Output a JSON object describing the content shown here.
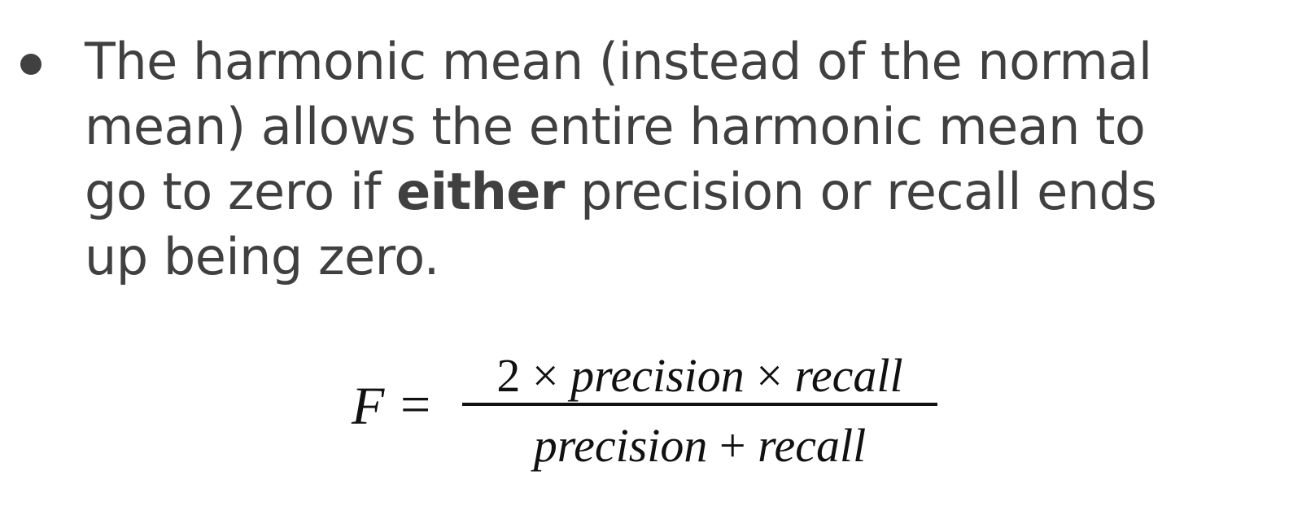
{
  "bullet": {
    "line1": "The harmonic mean (instead of the normal",
    "line2": "mean) allows the entire harmonic mean to",
    "line3_pre": "go to zero if ",
    "line3_bold": "either",
    "line3_post": " precision or recall ends",
    "line4": "up being zero."
  },
  "formula": {
    "lhs": "F",
    "equals": "=",
    "numerator": {
      "coefficient": "2",
      "times1": "×",
      "term1": "precision",
      "times2": "×",
      "term2": "recall"
    },
    "denominator": {
      "term1": "precision",
      "plus": "+",
      "term2": "recall"
    }
  }
}
